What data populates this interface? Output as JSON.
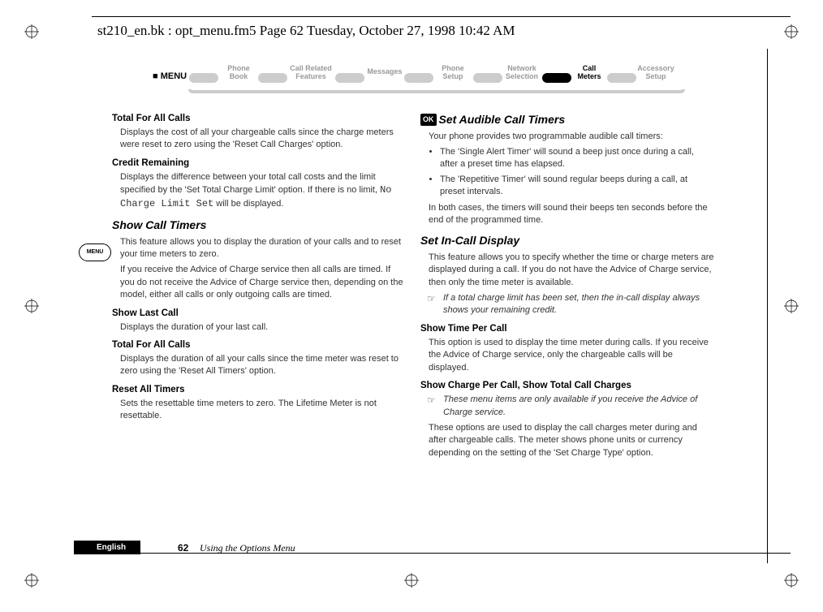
{
  "header": "st210_en.bk : opt_menu.fm5  Page 62  Tuesday, October 27, 1998  10:42 AM",
  "menu": {
    "start": "MENU",
    "items": [
      {
        "line1": "Phone",
        "line2": "Book"
      },
      {
        "line1": "Call Related",
        "line2": "Features"
      },
      {
        "line1": "Messages",
        "line2": ""
      },
      {
        "line1": "Phone",
        "line2": "Setup"
      },
      {
        "line1": "Network",
        "line2": "Selection"
      },
      {
        "line1": "Call",
        "line2": "Meters",
        "active": true
      },
      {
        "line1": "Accessory",
        "line2": "Setup"
      }
    ]
  },
  "side_button": "MENU",
  "left": {
    "s1_h": "Total For All Calls",
    "s1_p": "Displays the cost of all your chargeable calls since the charge meters were reset to zero using the 'Reset Call Charges' option.",
    "s2_h": "Credit Remaining",
    "s2_p1": "Displays the difference between your total call costs and the limit specified by the 'Set Total Charge Limit' option. If there is no limit, ",
    "s2_mono": "No Charge Limit Set",
    "s2_p2": " will be displayed.",
    "s3_h": "Show Call Timers",
    "s3_p1": "This feature allows you to display the duration of your calls and to reset your time meters to zero.",
    "s3_p2": "If you receive the Advice of Charge service then all calls are timed. If you do not receive the Advice of Charge service then, depending on the model, either all calls or only outgoing calls are timed.",
    "s4_h": "Show Last Call",
    "s4_p": "Displays the duration of your last call.",
    "s5_h": "Total For All Calls",
    "s5_p": "Displays the duration of all your calls since the time meter was reset to zero using the 'Reset All Timers' option.",
    "s6_h": "Reset All Timers",
    "s6_p": "Sets the resettable time meters to zero. The Lifetime Meter is not resettable."
  },
  "right": {
    "ok": "OK",
    "s1_h": "Set Audible Call Timers",
    "s1_p": "Your phone provides two programmable audible call timers:",
    "s1_b1": "The 'Single Alert Timer' will sound a beep just once during a call, after a preset time has elapsed.",
    "s1_b2": "The 'Repetitive Timer' will sound regular beeps during a call, at preset intervals.",
    "s1_p2": "In both cases, the timers will sound their beeps ten seconds before the end of the programmed time.",
    "s2_h": "Set In-Call Display",
    "s2_p": "This feature allows you to specify whether the time or charge meters are displayed during a call. If you do not have the Advice of Charge service, then only the time meter is available.",
    "s2_note": "If a total charge limit has been set, then the in-call display always shows your remaining credit.",
    "s3_h": "Show Time Per Call",
    "s3_p": "This option is used to display the time meter during calls. If you receive the Advice of Charge service, only the chargeable calls will be displayed.",
    "s4_h": "Show Charge Per Call, Show Total Call Charges",
    "s4_note": "These menu items are only available if you receive the Advice of Charge service.",
    "s4_p": "These options are used to display the call charges meter during and after chargeable calls. The meter shows phone units or currency depending on the setting of the 'Set Charge Type' option."
  },
  "footer": {
    "lang": "English",
    "page": "62",
    "section": "Using the Options Menu"
  }
}
